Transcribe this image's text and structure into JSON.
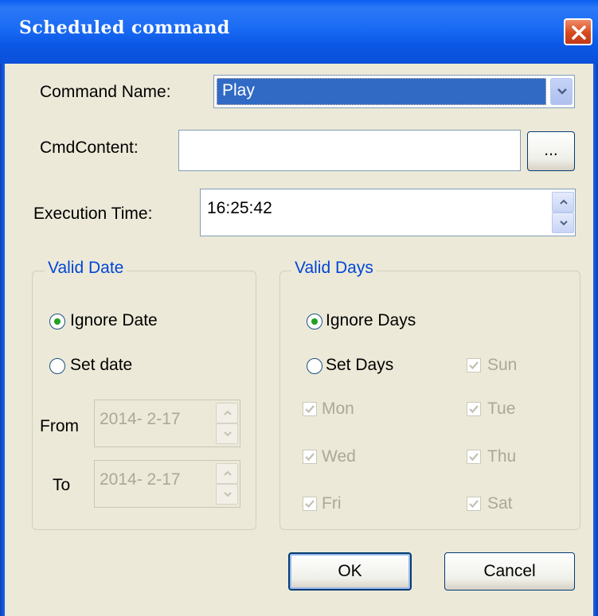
{
  "window": {
    "title": "Scheduled command",
    "close_label": "✕"
  },
  "form": {
    "command_name_label": "Command Name:",
    "command_name_value": "Play",
    "cmd_content_label": "CmdContent:",
    "cmd_content_value": "",
    "browse_label": "...",
    "execution_time_label": "Execution Time:",
    "execution_time_value": "16:25:42"
  },
  "valid_date": {
    "title": "Valid Date",
    "ignore_label": "Ignore Date",
    "set_label": "Set date",
    "from_label": "From",
    "from_value": "2014- 2-17",
    "to_label": "To",
    "to_value": "2014- 2-17",
    "selected": "ignore"
  },
  "valid_days": {
    "title": "Valid Days",
    "ignore_label": "Ignore Days",
    "set_label": "Set Days",
    "selected": "ignore",
    "days": [
      {
        "label": "Sun",
        "checked": true
      },
      {
        "label": "Mon",
        "checked": true
      },
      {
        "label": "Tue",
        "checked": true
      },
      {
        "label": "Wed",
        "checked": true
      },
      {
        "label": "Thu",
        "checked": true
      },
      {
        "label": "Fri",
        "checked": true
      },
      {
        "label": "Sat",
        "checked": true
      }
    ]
  },
  "buttons": {
    "ok": "OK",
    "cancel": "Cancel"
  },
  "colors": {
    "title_bar": "#0a5ef0",
    "selection": "#316ac5",
    "group_title": "#0046d5",
    "disabled_text": "#aca899",
    "radio_dot": "#21a121"
  },
  "icons": [
    "close-icon",
    "dropdown-arrow-icon",
    "spin-up-icon",
    "spin-down-icon",
    "checkmark-icon"
  ]
}
